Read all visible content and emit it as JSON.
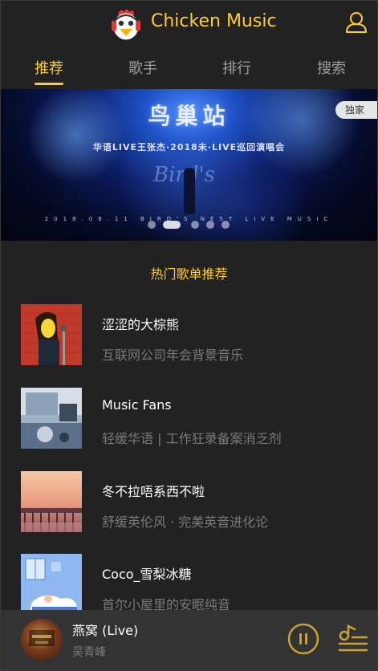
{
  "header": {
    "app_title": "Chicken Music",
    "logo_icon": "chicken-logo-icon",
    "user_icon": "user-icon"
  },
  "tabs": [
    {
      "label": "推荐",
      "active": true
    },
    {
      "label": "歌手",
      "active": false
    },
    {
      "label": "排行",
      "active": false
    },
    {
      "label": "搜索",
      "active": false
    }
  ],
  "banner": {
    "title": "鸟巢站",
    "subtitle": "华语LIVE王张杰·2018未·LIVE巡回演唱会",
    "date_line": "2018.08.11   BIRD'S NEST   LIVE   MUSIC",
    "badge": "独家",
    "slide_count": 6,
    "active_slide": 1
  },
  "hot_section": {
    "title": "热门歌单推荐",
    "items": [
      {
        "name": "涩涩的大棕熊",
        "desc": "互联网公司年会背景音乐"
      },
      {
        "name": "Music Fans",
        "desc": "轻缓华语 | 工作狂录备案消乏剂"
      },
      {
        "name": "冬不拉唔系西不啦",
        "desc": "舒缓英伦风 · 完美英音进化论"
      },
      {
        "name": "Coco_雪梨冰糖",
        "desc": "首尔小屋里的安眠纯音"
      }
    ]
  },
  "mini_player": {
    "song": "燕窝 (Live)",
    "singer": "吴青峰",
    "pause_icon": "pause-icon",
    "playlist_icon": "playlist-icon"
  },
  "colors": {
    "accent": "#ffcd32",
    "background": "#222222",
    "player_background": "#333333",
    "muted_text": "#7a7a7a"
  }
}
